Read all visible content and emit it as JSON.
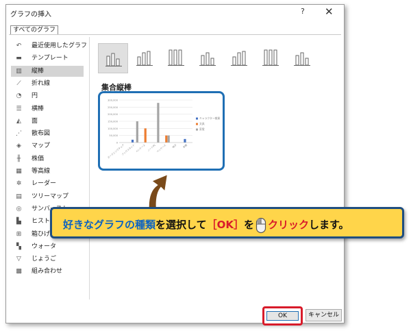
{
  "window": {
    "title": "グラフの挿入",
    "help": "?",
    "close": "✕"
  },
  "tab": "すべてのグラフ",
  "sidebar": {
    "items": [
      {
        "icon": "recent-icon",
        "label": "最近使用したグラフ"
      },
      {
        "icon": "template-folder-icon",
        "label": "テンプレート"
      },
      {
        "icon": "column-chart-icon",
        "label": "縦棒",
        "selected": true
      },
      {
        "icon": "line-chart-icon",
        "label": "折れ線"
      },
      {
        "icon": "pie-chart-icon",
        "label": "円"
      },
      {
        "icon": "bar-chart-icon",
        "label": "横棒"
      },
      {
        "icon": "area-chart-icon",
        "label": "面"
      },
      {
        "icon": "scatter-chart-icon",
        "label": "散布図"
      },
      {
        "icon": "map-chart-icon",
        "label": "マップ"
      },
      {
        "icon": "stock-chart-icon",
        "label": "株価"
      },
      {
        "icon": "surface-chart-icon",
        "label": "等高線"
      },
      {
        "icon": "radar-chart-icon",
        "label": "レーダー"
      },
      {
        "icon": "treemap-chart-icon",
        "label": "ツリーマップ"
      },
      {
        "icon": "sunburst-chart-icon",
        "label": "サンバースト"
      },
      {
        "icon": "histogram-chart-icon",
        "label": "ヒストグ"
      },
      {
        "icon": "box-chart-icon",
        "label": "箱ひげ図"
      },
      {
        "icon": "waterfall-chart-icon",
        "label": "ウォータ"
      },
      {
        "icon": "funnel-chart-icon",
        "label": "じょうご"
      },
      {
        "icon": "combo-chart-icon",
        "label": "組み合わせ"
      }
    ]
  },
  "chart_types": [
    {
      "name": "clustered-column",
      "selected": true
    },
    {
      "name": "stacked-column"
    },
    {
      "name": "100-stacked-column"
    },
    {
      "name": "3d-clustered-column"
    },
    {
      "name": "3d-stacked-column"
    },
    {
      "name": "3d-100-stacked-column"
    },
    {
      "name": "3d-column"
    }
  ],
  "subtype_title": "集合縦棒",
  "chart_data": {
    "type": "bar",
    "categories": [
      "ガーデニングチェア",
      "ブックスタンド",
      "ペンケース",
      "ノートPC",
      "ペンケース",
      "椅子",
      "本棚"
    ],
    "series": [
      {
        "name": "キャラクター雑貨",
        "color": "#4472c4",
        "values": [
          0,
          20000,
          0,
          0,
          0,
          0,
          25000
        ]
      },
      {
        "name": "文具",
        "color": "#ed7d31",
        "values": [
          0,
          0,
          100000,
          0,
          50000,
          0,
          0
        ]
      },
      {
        "name": "家電",
        "color": "#a5a5a5",
        "values": [
          0,
          150000,
          0,
          280000,
          50000,
          0,
          0
        ]
      }
    ],
    "yticks": [
      "300,000",
      "250,000",
      "200,000",
      "150,000",
      "100,000",
      "50,000",
      "0"
    ],
    "ylim": [
      0,
      300000
    ]
  },
  "callout": {
    "part1": "好きなグラフの種類",
    "part2": "を選択して",
    "part3": "［OK］",
    "part4": "を",
    "part5": "クリック",
    "part6": "します。"
  },
  "buttons": {
    "ok": "OK",
    "cancel": "キャンセル"
  }
}
